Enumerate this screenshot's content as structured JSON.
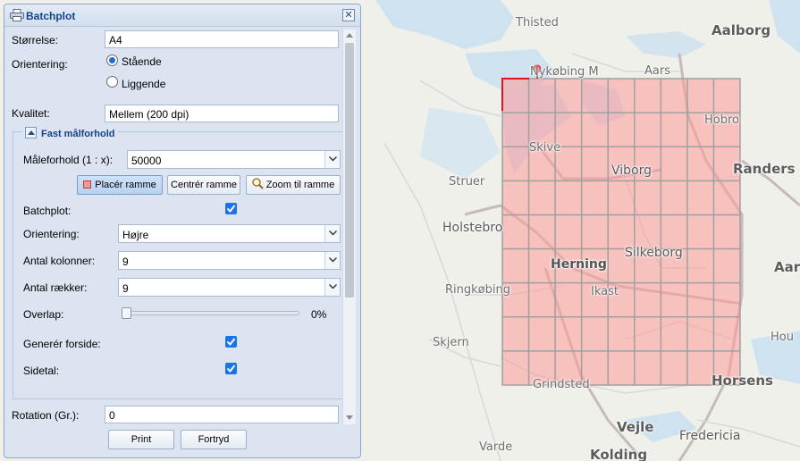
{
  "map": {
    "labels": [
      {
        "text": "Thisted"
      },
      {
        "text": "Aalborg"
      },
      {
        "text": "Nykøbing M"
      },
      {
        "text": "Aars"
      },
      {
        "text": "Hobro"
      },
      {
        "text": "Skive"
      },
      {
        "text": "Viborg"
      },
      {
        "text": "Randers"
      },
      {
        "text": "Struer"
      },
      {
        "text": "Holstebro"
      },
      {
        "text": "Silkeborg"
      },
      {
        "text": "Herning"
      },
      {
        "text": "Aar"
      },
      {
        "text": "Ringkøbing"
      },
      {
        "text": "Ikast"
      },
      {
        "text": "Skjern"
      },
      {
        "text": "Hou"
      },
      {
        "text": "Horsens"
      },
      {
        "text": "Grindsted"
      },
      {
        "text": "Vejle"
      },
      {
        "text": "Fredericia"
      },
      {
        "text": "Varde"
      },
      {
        "text": "Kolding"
      }
    ],
    "grid": {
      "columns": 9,
      "rows": 9,
      "fill_color": "#ff9a9a",
      "line_color": "#a0a0a0",
      "marker_color": "#e0141e"
    }
  },
  "panel": {
    "title": "Batchplot",
    "close_symbol": "✕",
    "size_label": "Størrelse:",
    "size_value": "A4",
    "orientation_label": "Orientering:",
    "portrait_label": "Stående",
    "landscape_label": "Liggende",
    "orientation_selected": "Stående",
    "quality_label": "Kvalitet:",
    "quality_value": "Mellem (200 dpi)",
    "fixed_scale": {
      "legend": "Fast målforhold",
      "scale_label": "Måleforhold (1 : x):",
      "scale_value": "50000",
      "place_frame_button": "Placér ramme",
      "center_frame_button": "Centrér ramme",
      "zoom_frame_button": "Zoom til ramme",
      "batchplot_label": "Batchplot:",
      "batchplot_checked": true,
      "orientation_label": "Orientering:",
      "orientation_value": "Højre",
      "columns_label": "Antal kolonner:",
      "columns_value": "9",
      "rows_label": "Antal rækker:",
      "rows_value": "9",
      "overlap_label": "Overlap:",
      "overlap_value": "0%",
      "overlap_fraction": 0,
      "cover_label": "Generér forside:",
      "cover_checked": true,
      "page_numbers_label": "Sidetal:",
      "page_numbers_checked": true
    },
    "rotation_label": "Rotation (Gr.):",
    "rotation_value": "0",
    "print_button": "Print",
    "cancel_button": "Fortryd"
  }
}
